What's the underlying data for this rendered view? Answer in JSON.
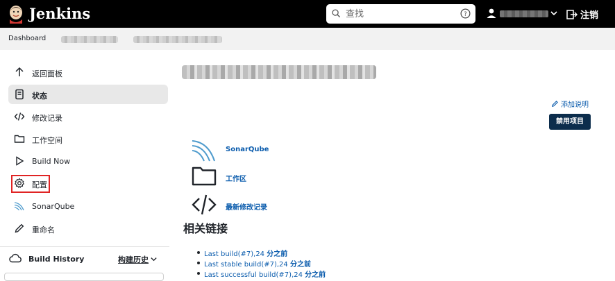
{
  "header": {
    "brand": "Jenkins",
    "search_placeholder": "查找",
    "logout_label": "注销"
  },
  "breadcrumb": {
    "root": "Dashboard"
  },
  "sidebar": {
    "items": [
      {
        "label": "返回面板",
        "icon": "arrow-up-icon"
      },
      {
        "label": "状态",
        "icon": "document-icon"
      },
      {
        "label": "修改记录",
        "icon": "code-icon"
      },
      {
        "label": "工作空间",
        "icon": "folder-icon"
      },
      {
        "label": "Build Now",
        "icon": "play-icon"
      },
      {
        "label": "配置",
        "icon": "gear-icon"
      },
      {
        "label": "SonarQube",
        "icon": "sonarqube-icon"
      },
      {
        "label": "重命名",
        "icon": "pencil-icon"
      }
    ],
    "build_history": {
      "label": "Build History",
      "trend_label": "构建历史"
    }
  },
  "main": {
    "add_description": "添加说明",
    "disable_button": "禁用项目",
    "links": [
      {
        "label": "SonarQube",
        "icon": "sonarqube-icon"
      },
      {
        "label": "工作区",
        "icon": "folder-icon"
      },
      {
        "label": "最新修改记录",
        "icon": "code-icon"
      }
    ],
    "related_title": "相关链接",
    "related_links": [
      {
        "prefix": "Last build(#7),24 ",
        "suffix": "分之前"
      },
      {
        "prefix": "Last stable build(#7),24 ",
        "suffix": "分之前"
      },
      {
        "prefix": "Last successful build(#7),24 ",
        "suffix": "分之前"
      }
    ]
  },
  "colors": {
    "topbar": "#000000",
    "link": "#0b5cad",
    "primary_button": "#0c2d4c",
    "highlight": "#e02424"
  }
}
